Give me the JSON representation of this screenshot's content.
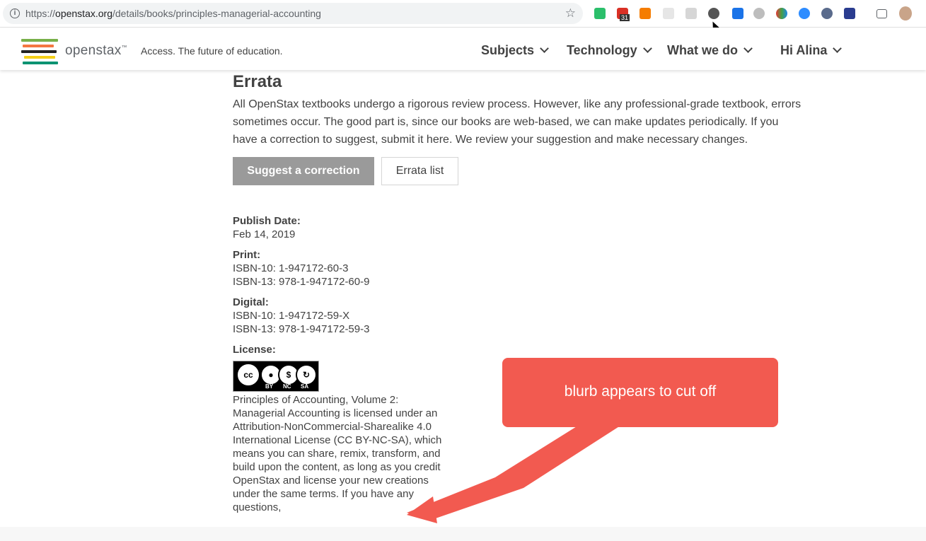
{
  "browser": {
    "url_prefix": "https://",
    "url_host": "openstax.org",
    "url_path": "/details/books/principles-managerial-accounting",
    "calendar_badge": "31"
  },
  "header": {
    "logo_text": "openstax",
    "logo_tm": "™",
    "tagline": "Access. The future of education.",
    "nav": [
      "Subjects",
      "Technology",
      "What we do",
      "Hi Alina"
    ]
  },
  "errata": {
    "title": "Errata",
    "text": "All OpenStax textbooks undergo a rigorous review process. However, like any professional-grade textbook, errors sometimes occur. The good part is, since our books are web-based, we can make updates periodically. If you have a correction to suggest, submit it here. We review your suggestion and make necessary changes.",
    "suggest_button": "Suggest a correction",
    "list_button": "Errata list"
  },
  "details": {
    "publish_label": "Publish Date:",
    "publish_value": "Feb 14, 2019",
    "print_label": "Print:",
    "print_isbn10": "ISBN-10: 1-947172-60-3",
    "print_isbn13": "ISBN-13: 978-1-947172-60-9",
    "digital_label": "Digital:",
    "digital_isbn10": "ISBN-10: 1-947172-59-X",
    "digital_isbn13": "ISBN-13: 978-1-947172-59-3",
    "license_label": "License:",
    "cc_tags": [
      "BY",
      "NC",
      "SA"
    ],
    "license_blurb": "Principles of Accounting, Volume 2: Managerial Accounting is licensed under an Attribution-NonCommercial-Sharealike 4.0 International License (CC BY-NC-SA), which means you can share, remix, transform, and build upon the content, as long as you credit OpenStax and license your new creations under the same terms. If you have any questions,"
  },
  "annotation": {
    "callout_text": "blurb appears to cut off",
    "color": "#f25a50"
  }
}
